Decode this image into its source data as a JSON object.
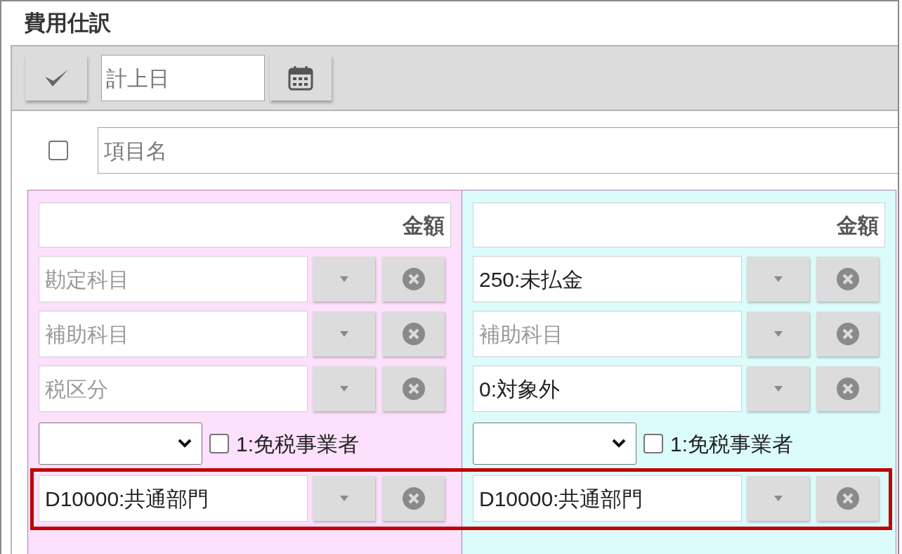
{
  "title": "費用仕訳",
  "toolbar": {
    "date_field": {
      "placeholder": "計上日"
    }
  },
  "item": {
    "checked": false,
    "name_field": {
      "placeholder": "項目名"
    }
  },
  "department_highlighted": true,
  "panels": [
    {
      "color": "#fde0fb",
      "amount": {
        "placeholder": "金額"
      },
      "lookups": [
        {
          "placeholder": "勘定科目"
        },
        {
          "placeholder": "補助科目"
        },
        {
          "placeholder": "税区分"
        }
      ],
      "exempt": {
        "label": "1:免税事業者",
        "checked": false
      },
      "department": {
        "value": "D10000:共通部門"
      }
    },
    {
      "color": "#dcfcfc",
      "amount": {
        "placeholder": "金額"
      },
      "lookups": [
        {
          "value": "250:未払金"
        },
        {
          "placeholder": "補助科目"
        },
        {
          "value": "0:対象外"
        }
      ],
      "exempt": {
        "label": "1:免税事業者",
        "checked": false
      },
      "department": {
        "value": "D10000:共通部門"
      }
    }
  ]
}
